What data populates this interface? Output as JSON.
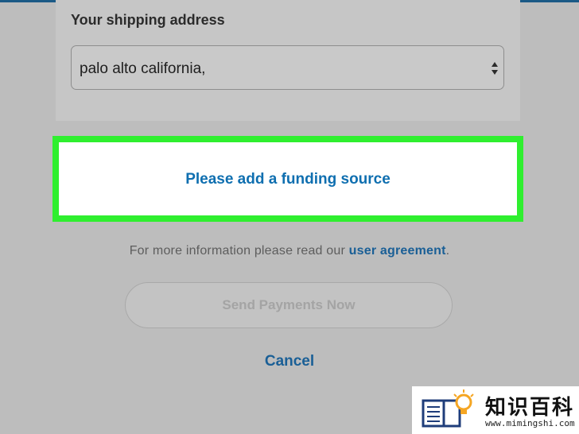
{
  "shipping": {
    "title": "Your shipping address",
    "selected_address": "palo alto california,"
  },
  "funding": {
    "link_label": "Please add a funding source",
    "highlight_color": "#2fef2f"
  },
  "info": {
    "text_before": "For more information please read our ",
    "link_label": "user agreement",
    "text_after": "."
  },
  "actions": {
    "send_label": "Send Payments Now",
    "cancel_label": "Cancel"
  },
  "watermark": {
    "title": "知识百科",
    "url": "www.mimingshi.com"
  },
  "colors": {
    "link": "#1a5f96",
    "background": "#bdbdbd"
  }
}
